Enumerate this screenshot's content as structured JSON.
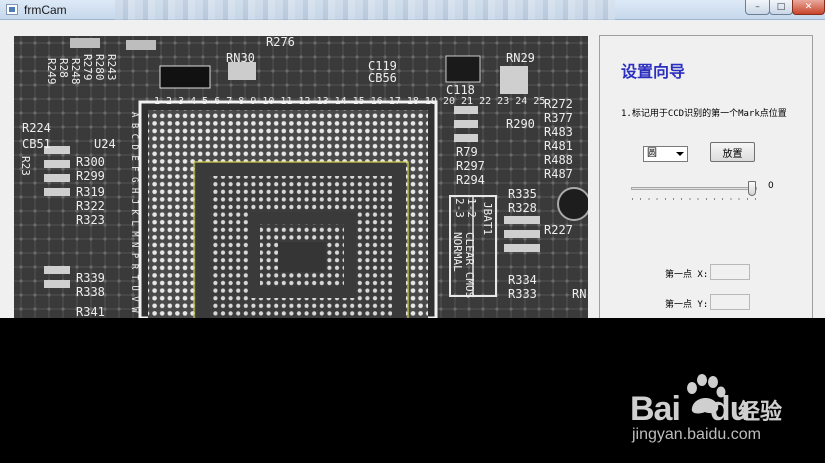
{
  "window": {
    "title": "frmCam",
    "controls": {
      "minimize": "–",
      "maximize": "□",
      "close": "✕"
    }
  },
  "board": {
    "top_labels": [
      "R276",
      "RN30",
      "C119",
      "CB56",
      "C118",
      "RN29",
      "R279",
      "R280",
      "R243",
      "R248",
      "R28",
      "R249"
    ],
    "pin_numbers": "1 2 3 4 5 6 7 8 9 10 11 12 13 14 15 16 17 18 19 20 21 22 23 24 25",
    "left_labels": [
      "R224",
      "CB51",
      "U24",
      "R300",
      "R299",
      "R319",
      "R322",
      "R323",
      "R339",
      "R338",
      "R341",
      "R23"
    ],
    "row_letters": "A B C D E F G H J K L M N P R T U V W Y AA",
    "right_labels": [
      "R272",
      "R377",
      "R483",
      "R481",
      "R488",
      "R487",
      "R290",
      "R79",
      "R297",
      "R294",
      "R335",
      "R328",
      "R227",
      "R334",
      "R333",
      "RN"
    ],
    "jumper": {
      "title": "JBAT1",
      "col1": "2-3",
      "col2": "1-2",
      "text1": "CLEAR CMOS",
      "text2": "NORMAL"
    }
  },
  "panel": {
    "title": "设置向导",
    "instruction": "1.标记用于CCD识别的第一个Mark点位置",
    "shape_select": {
      "selected": "圆"
    },
    "place_button": "放置",
    "slider": {
      "value": 0,
      "value_label": "0",
      "position_fraction": 0.94
    },
    "point_x_label": "第一点 X:",
    "point_y_label": "第一点 Y:",
    "point_x_value": "",
    "point_y_value": ""
  },
  "watermark": {
    "brand": "Bai",
    "brand2": "du",
    "cn": "经验",
    "url": "jingyan.baidu.com"
  }
}
